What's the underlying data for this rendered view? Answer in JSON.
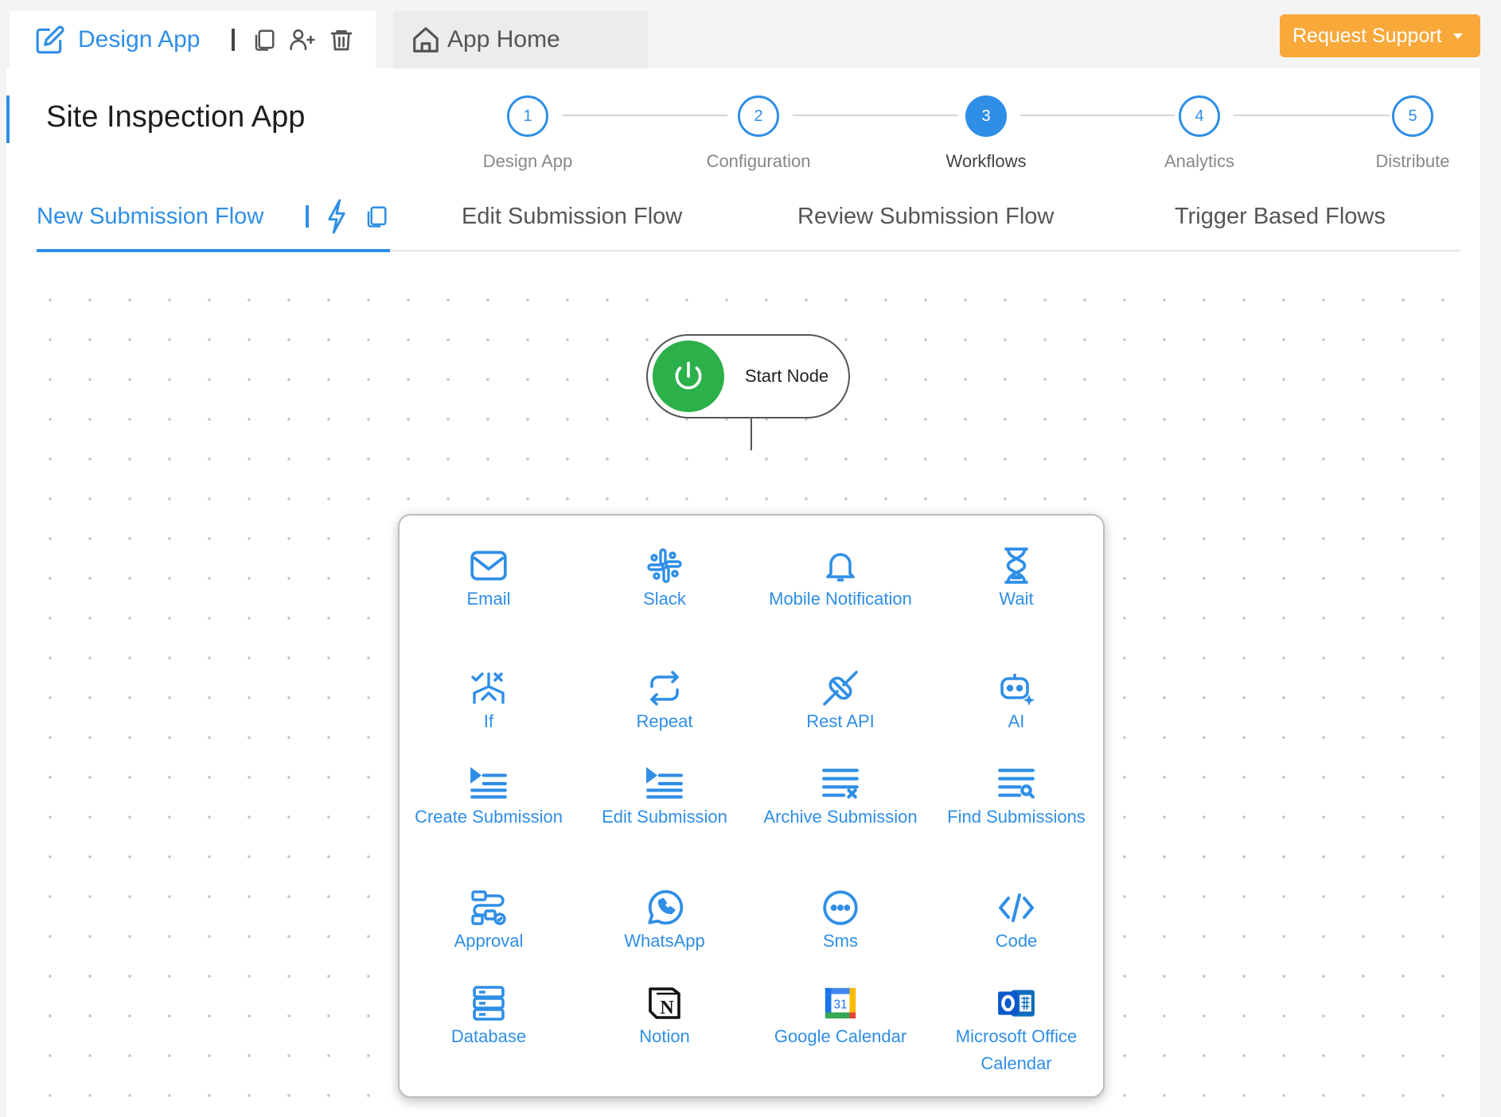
{
  "header": {
    "design_title": "Design App",
    "home_label": "App Home",
    "support_label": "Request Support"
  },
  "page": {
    "title": "Site Inspection App"
  },
  "stepper": {
    "steps": [
      {
        "num": "1",
        "label": "Design App"
      },
      {
        "num": "2",
        "label": "Configuration"
      },
      {
        "num": "3",
        "label": "Workflows"
      },
      {
        "num": "4",
        "label": "Analytics"
      },
      {
        "num": "5",
        "label": "Distribute"
      }
    ],
    "active_step": 3
  },
  "flow_tabs": [
    {
      "label": "New Submission Flow"
    },
    {
      "label": "Edit Submission Flow"
    },
    {
      "label": "Review Submission Flow"
    },
    {
      "label": "Trigger Based Flows"
    }
  ],
  "start_node": {
    "label": "Start Node"
  },
  "palette": {
    "items": [
      {
        "label": "Email",
        "icon": "mail-icon"
      },
      {
        "label": "Slack",
        "icon": "slack-icon"
      },
      {
        "label": "Mobile Notification",
        "icon": "bell-icon"
      },
      {
        "label": "Wait",
        "icon": "hourglass-icon"
      },
      {
        "label": "If",
        "icon": "condition-icon"
      },
      {
        "label": "Repeat",
        "icon": "repeat-icon"
      },
      {
        "label": "Rest API",
        "icon": "plug-icon"
      },
      {
        "label": "AI",
        "icon": "robot-icon"
      },
      {
        "label": "Create Submission",
        "icon": "list-create-icon"
      },
      {
        "label": "Edit Submission",
        "icon": "list-edit-icon"
      },
      {
        "label": "Archive Submission",
        "icon": "list-archive-icon"
      },
      {
        "label": "Find Submissions",
        "icon": "list-search-icon"
      },
      {
        "label": "Approval",
        "icon": "approval-icon"
      },
      {
        "label": "WhatsApp",
        "icon": "whatsapp-icon"
      },
      {
        "label": "Sms",
        "icon": "sms-icon"
      },
      {
        "label": "Code",
        "icon": "code-icon"
      },
      {
        "label": "Database",
        "icon": "database-icon"
      },
      {
        "label": "Notion",
        "icon": "notion-icon"
      },
      {
        "label": "Google Calendar",
        "icon": "google-calendar-icon"
      },
      {
        "label": "Microsoft Office Calendar",
        "icon": "outlook-calendar-icon"
      }
    ],
    "google_calendar_day": "31"
  },
  "colors": {
    "accent": "#2f8ee6",
    "support": "#f9a83a",
    "start": "#2bb04a"
  }
}
